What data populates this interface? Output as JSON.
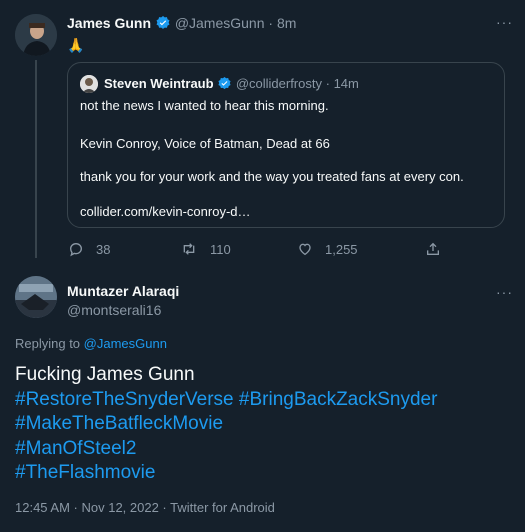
{
  "tweet1": {
    "name": "James Gunn",
    "handle": "@JamesGunn",
    "sep": "·",
    "time": "8m",
    "text": "🙏",
    "quote": {
      "name": "Steven Weintraub",
      "handle": "@colliderfrosty",
      "sep": "·",
      "time": "14m",
      "line1": "not the news I wanted to hear this morning.",
      "line2": "Kevin Conroy, Voice of Batman, Dead at 66",
      "line3": "thank you for your work and the way you treated fans at every con.",
      "line4": "collider.com/kevin-conroy-d…"
    },
    "actions": {
      "reply": "38",
      "retweet": "110",
      "like": "1,255"
    },
    "more": "···"
  },
  "tweet2": {
    "name": "Muntazer Alaraqi",
    "handle": "@montserali16",
    "more": "···",
    "replying_prefix": "Replying to",
    "replying_to": "@JamesGunn",
    "text_plain": "Fucking James Gunn",
    "hashtags_line1a": "#RestoreTheSnyderVerse",
    "hashtags_line1b": "#BringBackZackSnyder",
    "hashtag2": "#MakeTheBatfleckMovie",
    "hashtag3": "#ManOfSteel2",
    "hashtag4": "#TheFlashmovie",
    "date": "12:45 AM · Nov 12, 2022 · Twitter for Android"
  },
  "colors": {
    "background": "#15202b",
    "accent": "#1d9bf0",
    "muted": "#8b98a5"
  }
}
